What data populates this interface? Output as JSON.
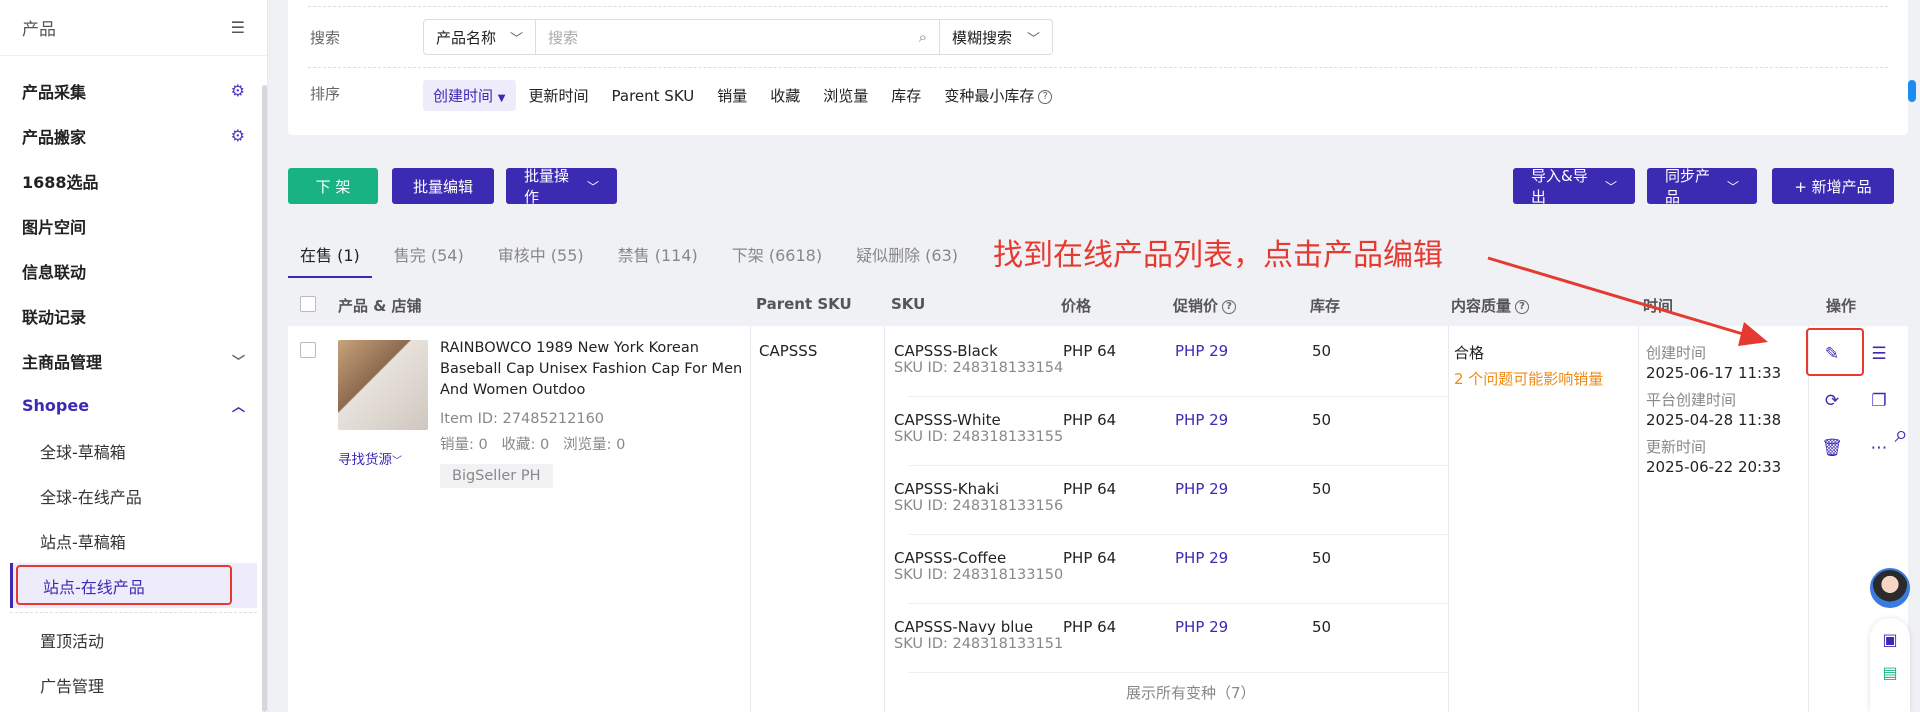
{
  "sidebar": {
    "title": "产品",
    "items": [
      {
        "label": "产品采集"
      },
      {
        "label": "产品搬家"
      },
      {
        "label": "1688选品"
      },
      {
        "label": "图片空间"
      },
      {
        "label": "信息联动"
      },
      {
        "label": "联动记录"
      },
      {
        "label": "主商品管理"
      },
      {
        "label": "Shopee"
      }
    ],
    "sub_items": [
      {
        "label": "全球-草稿箱"
      },
      {
        "label": "全球-在线产品"
      },
      {
        "label": "站点-草稿箱"
      },
      {
        "label": "站点-在线产品"
      },
      {
        "label": "置顶活动"
      },
      {
        "label": "广告管理"
      }
    ]
  },
  "filters": {
    "search_label": "搜索",
    "search_field": "产品名称",
    "search_placeholder": "搜索",
    "search_mode": "模糊搜索",
    "sort_label": "排序",
    "sort_items": [
      "创建时间",
      "更新时间",
      "Parent SKU",
      "销量",
      "收藏",
      "浏览量",
      "库存",
      "变种最小库存"
    ]
  },
  "toolbar": {
    "delist": "下 架",
    "bulk_edit": "批量编辑",
    "bulk_ops": "批量操作",
    "import_export": "导入&导出",
    "sync": "同步产品",
    "add": "+ 新增产品"
  },
  "tabs": [
    "在售 (1)",
    "售完 (54)",
    "审核中 (55)",
    "禁售 (114)",
    "下架 (6618)",
    "疑似删除 (63)"
  ],
  "annotation": "找到在线产品列表，点击产品编辑",
  "table": {
    "headers": [
      "产品 & 店铺",
      "Parent SKU",
      "SKU",
      "价格",
      "促销价",
      "库存",
      "内容质量",
      "时间",
      "操作"
    ],
    "product": {
      "title": "RAINBOWCO 1989 New York Korean Baseball Cap Unisex Fashion Cap For Men And Women Outdoo",
      "item_id": "Item ID: 27485212160",
      "stats": "销量: 0   收藏: 0   浏览量: 0",
      "find_source": "寻找货源",
      "shop": "BigSeller PH",
      "parent_sku": "CAPSSS",
      "quality": "合格",
      "quality_warn": "2 个问题可能影响销量",
      "time_created_label": "创建时间",
      "time_created": "2025-06-17 11:33",
      "time_platform_label": "平台创建时间",
      "time_platform": "2025-04-28 11:38",
      "time_updated_label": "更新时间",
      "time_updated": "2025-06-22 20:33"
    },
    "variants": [
      {
        "sku": "CAPSSS-Black",
        "sku_id": "SKU ID: 248318133154",
        "price": "PHP 64",
        "promo": "PHP 29",
        "stock": "50"
      },
      {
        "sku": "CAPSSS-White",
        "sku_id": "SKU ID: 248318133155",
        "price": "PHP 64",
        "promo": "PHP 29",
        "stock": "50"
      },
      {
        "sku": "CAPSSS-Khaki",
        "sku_id": "SKU ID: 248318133156",
        "price": "PHP 64",
        "promo": "PHP 29",
        "stock": "50"
      },
      {
        "sku": "CAPSSS-Coffee",
        "sku_id": "SKU ID: 248318133150",
        "price": "PHP 64",
        "promo": "PHP 29",
        "stock": "50"
      },
      {
        "sku": "CAPSSS-Navy blue",
        "sku_id": "SKU ID: 248318133151",
        "price": "PHP 64",
        "promo": "PHP 29",
        "stock": "50"
      }
    ],
    "expand_all": "展示所有变种（7）"
  },
  "colors": {
    "accent": "#3b2bb3",
    "green": "#19b383",
    "red": "#e53a2f",
    "warn": "#f08a14"
  }
}
